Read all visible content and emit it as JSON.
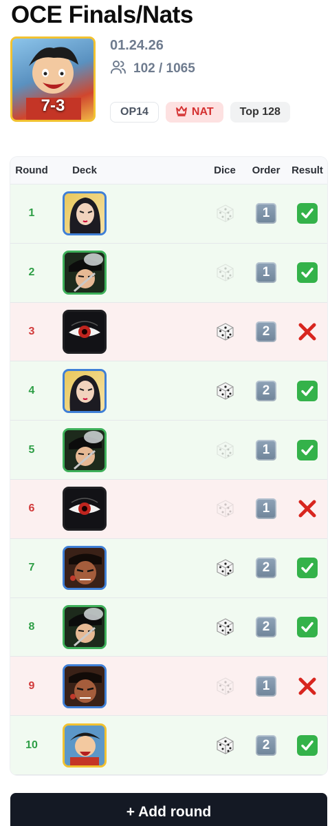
{
  "event": {
    "title": "OCE Finals/Nats",
    "date": "01.24.26",
    "players": "102 / 1065",
    "players_icon": "users-icon",
    "record": "7-3",
    "hero_leader": "luffy-leader-art",
    "tags": {
      "set": "OP14",
      "tier": "NAT",
      "tier_icon": "crown-icon",
      "placement": "Top 128"
    }
  },
  "colors": {
    "win_bg": "#f1faf1",
    "loss_bg": "#fcf0f0",
    "win_text": "#2e9e46",
    "loss_text": "#d13a3a",
    "border_blue": "#3f7fd6",
    "border_green": "#3eb05a",
    "border_yellow": "#f2c230",
    "border_red": "#c0392b"
  },
  "table": {
    "headers": {
      "round": "Round",
      "deck": "Deck",
      "dice": "Dice",
      "order": "Order",
      "result": "Result"
    },
    "rows": [
      {
        "round": "1",
        "deck": "boa-hancock-leader",
        "deck_color": "blue-yellow",
        "dice_won": false,
        "order": "1",
        "result": "win"
      },
      {
        "round": "2",
        "deck": "shanks-leader",
        "deck_color": "green-red",
        "dice_won": false,
        "order": "1",
        "result": "win"
      },
      {
        "round": "3",
        "deck": "imu-leader",
        "deck_color": "black",
        "dice_won": true,
        "order": "2",
        "result": "loss"
      },
      {
        "round": "4",
        "deck": "boa-hancock-leader",
        "deck_color": "blue-yellow",
        "dice_won": true,
        "order": "2",
        "result": "win"
      },
      {
        "round": "5",
        "deck": "shanks-leader",
        "deck_color": "green-red",
        "dice_won": false,
        "order": "1",
        "result": "win"
      },
      {
        "round": "6",
        "deck": "imu-leader",
        "deck_color": "black",
        "dice_won": false,
        "order": "1",
        "result": "loss"
      },
      {
        "round": "7",
        "deck": "ace-leader",
        "deck_color": "red-blue",
        "dice_won": true,
        "order": "2",
        "result": "win"
      },
      {
        "round": "8",
        "deck": "shanks-leader",
        "deck_color": "green-red",
        "dice_won": true,
        "order": "2",
        "result": "win"
      },
      {
        "round": "9",
        "deck": "ace-leader",
        "deck_color": "red-blue",
        "dice_won": false,
        "order": "1",
        "result": "loss"
      },
      {
        "round": "10",
        "deck": "luffy-leader",
        "deck_color": "yellow-red",
        "dice_won": true,
        "order": "2",
        "result": "win"
      }
    ]
  },
  "actions": {
    "add_round": "+ Add round"
  }
}
